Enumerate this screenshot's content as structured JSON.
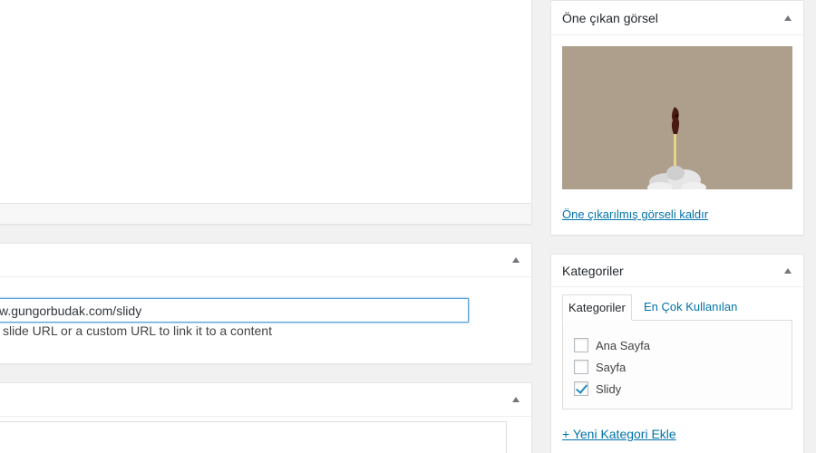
{
  "link_box": {
    "url_value": "w.gungorbudak.com/slidy",
    "description": " slide URL or a custom URL to link it to a content"
  },
  "featured_image": {
    "title": "Öne çıkan görsel",
    "remove_link": "Öne çıkarılmış görseli kaldır"
  },
  "categories": {
    "title": "Kategoriler",
    "tabs": [
      "Kategoriler",
      "En Çok Kullanılan"
    ],
    "items": [
      {
        "label": "Ana Sayfa",
        "checked": false
      },
      {
        "label": "Sayfa",
        "checked": false
      },
      {
        "label": "Slidy",
        "checked": true
      }
    ],
    "add_link": "+ Yeni Kategori Ekle"
  },
  "colors": {
    "link": "#0073aa",
    "focus_border": "#5b9dd9",
    "image_background": "#ae9f8d"
  }
}
